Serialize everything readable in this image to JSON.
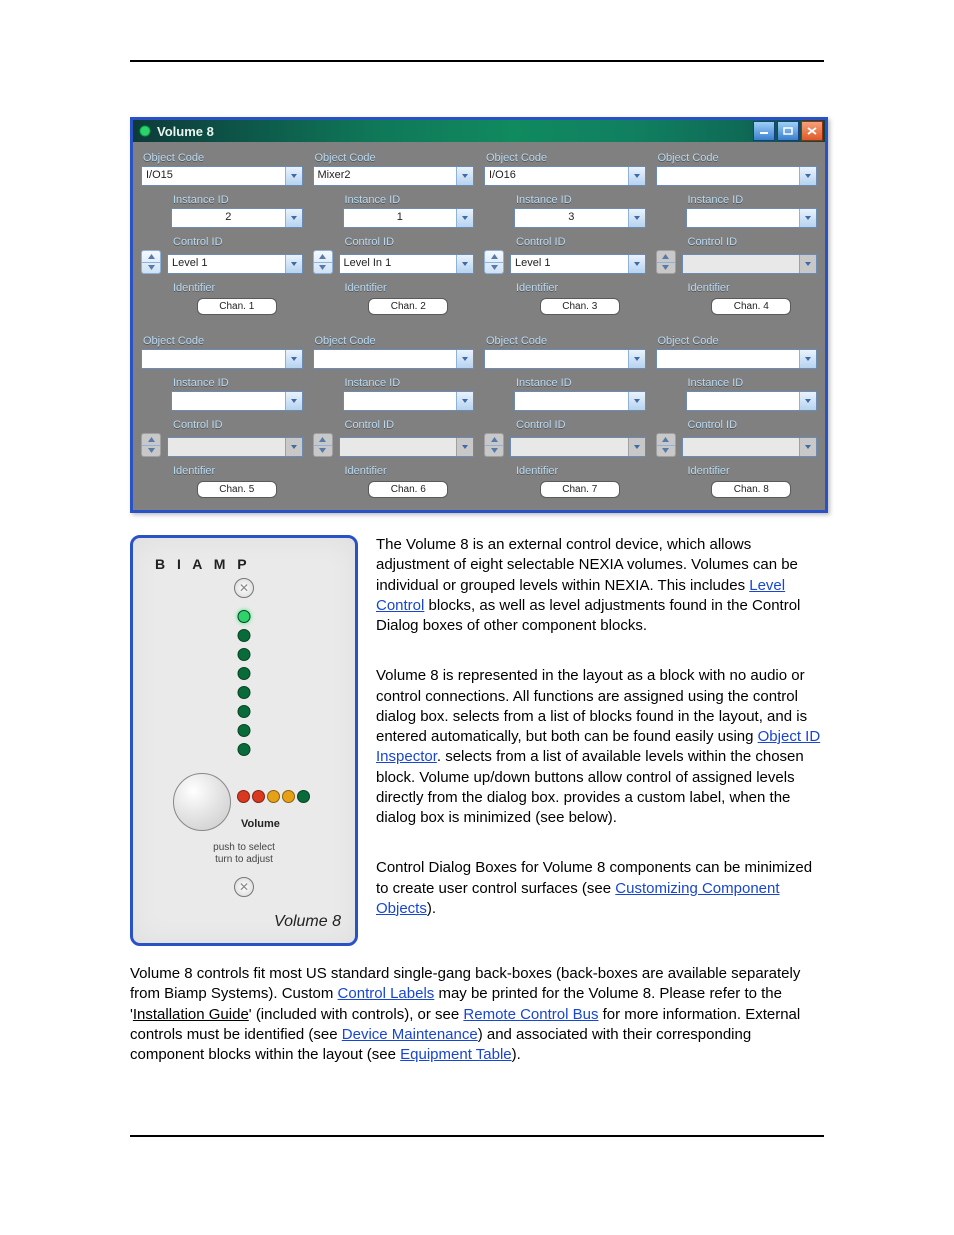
{
  "page_title": "Volume 8",
  "window": {
    "title": "Volume 8",
    "buttons": {
      "min": "_",
      "max": "□",
      "close": "×"
    }
  },
  "labels": {
    "object_code": "Object Code",
    "instance_id": "Instance ID",
    "control_id": "Control ID",
    "identifier": "Identifier"
  },
  "channels": [
    {
      "object_code": "I/O15",
      "instance_id": "2",
      "control_id": "Level 1",
      "identifier": "Chan. 1",
      "enabled": true
    },
    {
      "object_code": "Mixer2",
      "instance_id": "1",
      "control_id": "Level In 1",
      "identifier": "Chan. 2",
      "enabled": true
    },
    {
      "object_code": "I/O16",
      "instance_id": "3",
      "control_id": "Level 1",
      "identifier": "Chan. 3",
      "enabled": true
    },
    {
      "object_code": "",
      "instance_id": "",
      "control_id": "",
      "identifier": "Chan. 4",
      "enabled": false
    },
    {
      "object_code": "",
      "instance_id": "",
      "control_id": "",
      "identifier": "Chan. 5",
      "enabled": false
    },
    {
      "object_code": "",
      "instance_id": "",
      "control_id": "",
      "identifier": "Chan. 6",
      "enabled": false
    },
    {
      "object_code": "",
      "instance_id": "",
      "control_id": "",
      "identifier": "Chan. 7",
      "enabled": false
    },
    {
      "object_code": "",
      "instance_id": "",
      "control_id": "",
      "identifier": "Chan. 8",
      "enabled": false
    }
  ],
  "panel": {
    "brand": "B I A M P",
    "volume": "Volume",
    "push": "push to select\nturn to adjust",
    "model": "Volume 8",
    "hled_colors": [
      "#d93a1f",
      "#d93a1f",
      "#e6a117",
      "#e6a117",
      "#0a6b3a"
    ]
  },
  "para": {
    "p1a": "The Volume 8 is an external control device, which allows adjustment of eight selectable NEXIA volumes. Volumes can be individual or grouped levels within NEXIA. This includes ",
    "p1_link": "Level Control",
    "p1b": " blocks, as well as level adjustments found in the Control Dialog boxes of other component blocks.",
    "p2a": "Volume 8 is represented in the layout as a block with no audio or control connections. All functions are assigned using the control dialog box. ",
    "p2b": " selects from a list of blocks found in the layout, and ",
    "p2c": " is entered automatically, but both can be found easily using ",
    "p2_link": "Object ID Inspector",
    "p2d": ". ",
    "p2e": " selects from a list of available levels within the chosen block. Volume up/down buttons allow control of assigned levels directly from the dialog box. ",
    "p2f": " provides a custom label, when the dialog box is minimized (see below).",
    "p3a": "Control Dialog Boxes for Volume 8 components can be minimized to create user control surfaces (see ",
    "p3_link": "Customizing Component Objects",
    "p3b": ").",
    "p4a": "Volume 8 controls fit most US standard single-gang back-boxes (back-boxes are available separately from Biamp Systems). Custom ",
    "p4_link1": "Control Labels",
    "p4b": " may be printed for the Volume 8. Please refer to the '",
    "p4_ul": "Installation Guide",
    "p4c": "' (included with controls), or see ",
    "p4_link2": "Remote Control Bus",
    "p4d": " for more information. External controls must be identified (see ",
    "p4_link3": "Device Maintenance",
    "p4e": ") and associated with their corresponding component blocks within the layout (see ",
    "p4_link4": "Equipment Table",
    "p4f": ")."
  }
}
